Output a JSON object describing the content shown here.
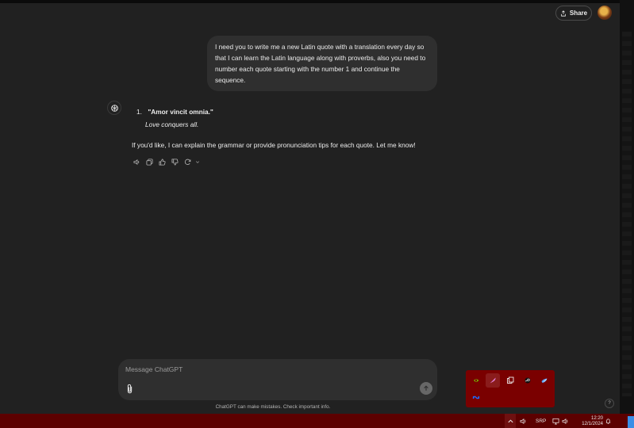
{
  "header": {
    "share_label": "Share"
  },
  "conversation": {
    "user_message": "I need you to write me a new Latin quote with a translation every day so that I can learn the Latin language along with proverbs, also you need to number each quote starting with the number 1 and continue the sequence.",
    "assistant": {
      "quote_number": "1.",
      "quote_latin": "\"Amor vincit omnia.\"",
      "quote_translation": "Love conquers all.",
      "followup": "If you'd like, I can explain the grammar or provide pronunciation tips for each quote. Let me know!"
    },
    "action_icons": [
      "speaker-icon",
      "copy-icon",
      "thumbs-up-icon",
      "thumbs-down-icon",
      "regenerate-icon",
      "chevron-down-icon"
    ]
  },
  "composer": {
    "placeholder": "Message ChatGPT"
  },
  "footer": {
    "disclaimer": "ChatGPT can make mistakes. Check important info.",
    "help_label": "?"
  },
  "tray_popup": {
    "icons": [
      "nvidia-icon",
      "feather-icon",
      "copy-app-icon",
      "steam-like-icon",
      "bird-icon",
      "meta-icon"
    ]
  },
  "taskbar": {
    "language": "SRP",
    "time": "12:20",
    "date": "12/1/2024",
    "colors": {
      "taskbar": "#5c0000",
      "popup": "#7a0000"
    }
  },
  "colors": {
    "background": "#212121",
    "bubble": "#2f2f2f",
    "text": "#ececec"
  }
}
